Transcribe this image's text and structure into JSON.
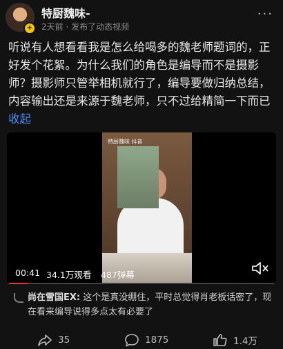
{
  "author": {
    "name": "特厨魏味-",
    "badge": "+"
  },
  "post": {
    "meta": "2天前 · 发布了动态视频",
    "text": "听说有人想看看我是怎么给喝多的魏老师题词的，正好发个花絮。为什么我们的角色是编导而不是摄影师？摄影师只管举相机就行了，编导要做归纳总结，内容输出还是来源于魏老师，只不过给精简一下而已 ",
    "collapse_label": "收起"
  },
  "video": {
    "watermark": "特厨魏味 抖音",
    "time": "00:41",
    "views": "34.1万观看",
    "danmu": "487弹幕",
    "progress": 0.08
  },
  "comment": {
    "user": "尚在雪国EX:",
    "text": " 这个是真没绷住，平时总觉得肖老板话密了，现在看来编导说得多点太有必要了"
  },
  "actions": {
    "share_count": "35",
    "comment_count": "1875",
    "like_count": "1.4万"
  },
  "icons": {
    "more": "more-icon",
    "mute": "mute-icon",
    "share": "share-icon",
    "comment": "comment-icon",
    "like": "like-icon"
  },
  "colors": {
    "accent": "#4d8df5",
    "background": "#121212",
    "badge": "#f5c400"
  }
}
